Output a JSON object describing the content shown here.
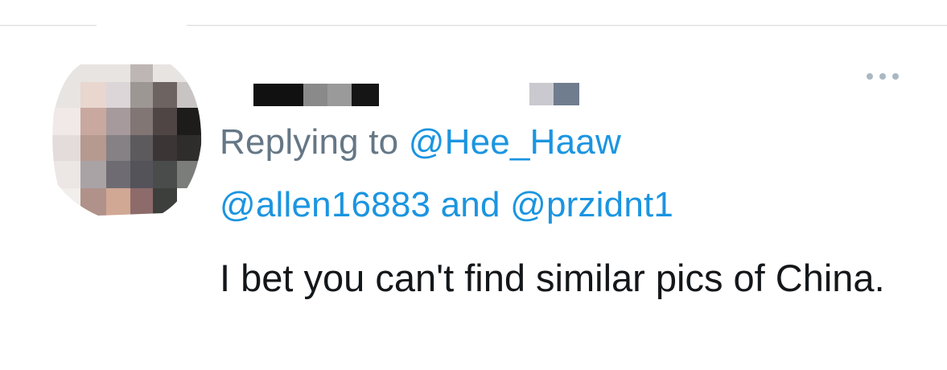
{
  "reply": {
    "prefix": "Replying to",
    "handles": [
      "@Hee_Haaw",
      "@allen16883",
      "@przidnt1"
    ],
    "conjunction": "and"
  },
  "tweet": {
    "text": "I bet you can't find similar pics of China."
  },
  "icons": {
    "avatar": "avatar-pixelated",
    "more": "more-options-icon"
  },
  "colors": {
    "link": "#1b95e0",
    "muted": "#657786",
    "text": "#14171a",
    "divider": "#d6d9dc"
  }
}
